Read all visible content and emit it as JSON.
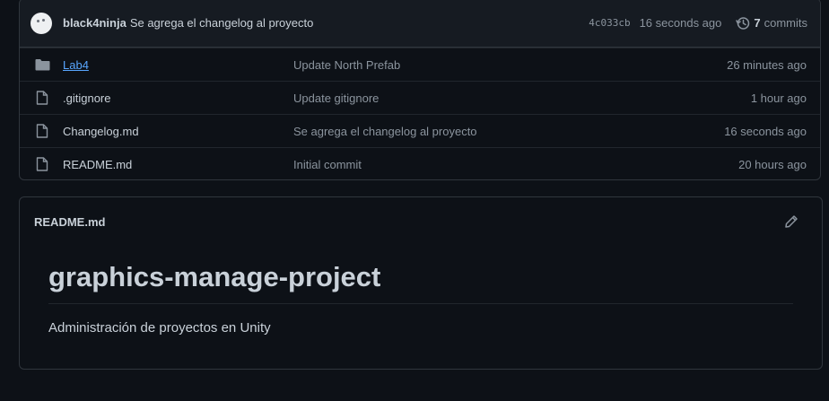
{
  "latest_commit": {
    "author": "black4ninja",
    "message": "Se agrega el changelog al proyecto",
    "sha": "4c033cb",
    "time": "16 seconds ago",
    "commit_count": "7",
    "commits_label": "commits"
  },
  "files": [
    {
      "type": "folder",
      "icon": "folder-icon",
      "name": "Lab4",
      "message": "Update North Prefab",
      "age": "26 minutes ago"
    },
    {
      "type": "file",
      "icon": "file-icon",
      "name": ".gitignore",
      "message": "Update gitignore",
      "age": "1 hour ago"
    },
    {
      "type": "file",
      "icon": "file-icon",
      "name": "Changelog.md",
      "message": "Se agrega el changelog al proyecto",
      "age": "16 seconds ago"
    },
    {
      "type": "file",
      "icon": "file-icon",
      "name": "README.md",
      "message": "Initial commit",
      "age": "20 hours ago"
    }
  ],
  "readme": {
    "filename": "README.md",
    "heading": "graphics-manage-project",
    "paragraph": "Administración de proyectos en Unity"
  },
  "colors": {
    "background": "#0d1117",
    "border": "#30363d",
    "link": "#58a6ff",
    "text": "#c9d1d9",
    "muted": "#8b949e"
  }
}
